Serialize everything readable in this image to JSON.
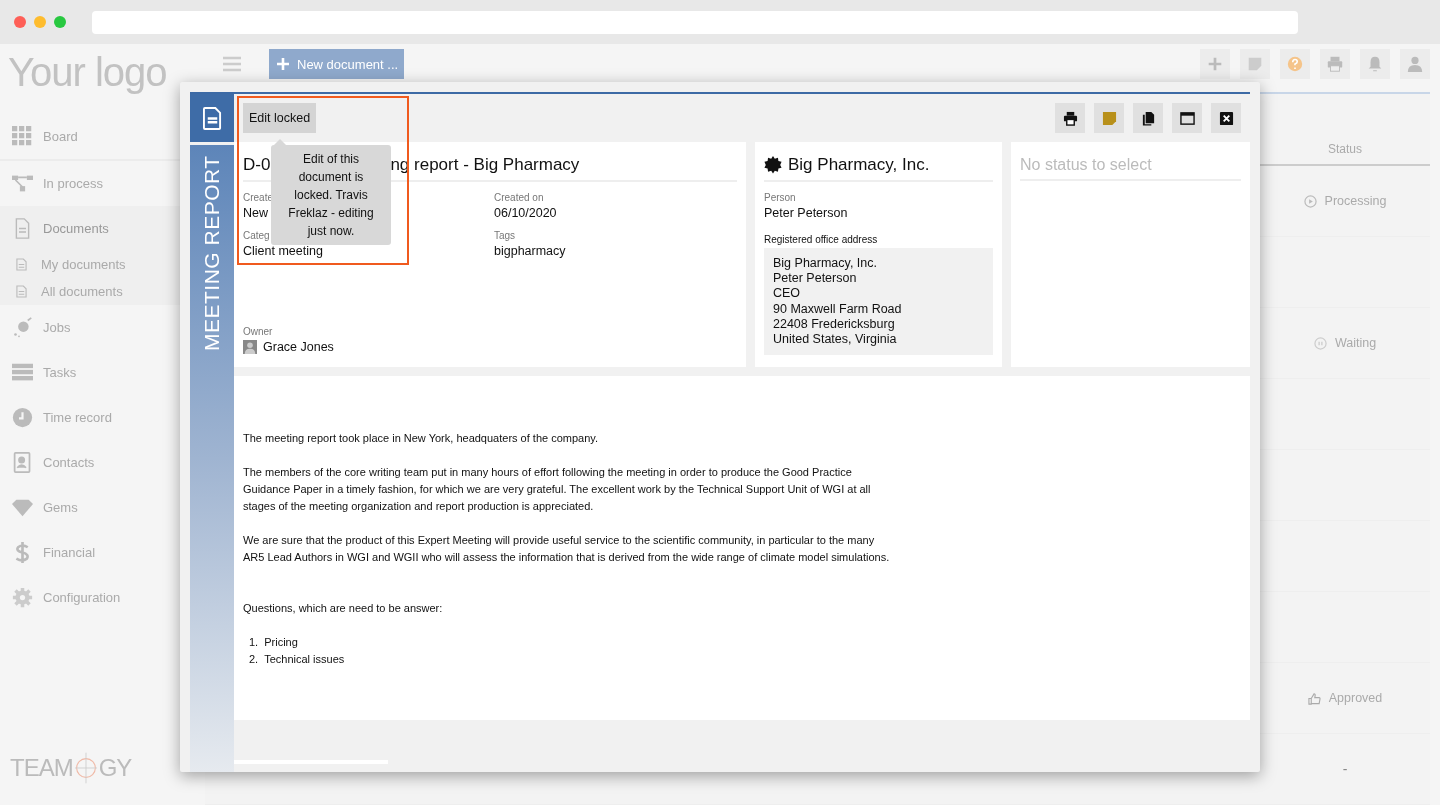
{
  "app": {
    "logo": "Your logo",
    "new_document_button": "New document ...",
    "brand": {
      "left": "TEAM",
      "right": "GY"
    }
  },
  "top_icons": [
    {
      "kind": "plus"
    },
    {
      "kind": "note"
    },
    {
      "kind": "help"
    },
    {
      "kind": "print"
    },
    {
      "kind": "bell"
    },
    {
      "kind": "user"
    }
  ],
  "sidebar": {
    "items": [
      {
        "label": "Board",
        "selected": false
      },
      {
        "label": "In process",
        "selected": false
      },
      {
        "label": "Documents",
        "selected": true,
        "children": [
          {
            "label": "My documents"
          },
          {
            "label": "All documents"
          }
        ]
      },
      {
        "label": "Jobs",
        "selected": false
      },
      {
        "label": "Tasks",
        "selected": false
      },
      {
        "label": "Time record",
        "selected": false
      },
      {
        "label": "Contacts",
        "selected": false
      },
      {
        "label": "Gems",
        "selected": false
      },
      {
        "label": "Financial",
        "selected": false
      },
      {
        "label": "Configuration",
        "selected": false
      }
    ]
  },
  "table": {
    "columns": [
      {
        "label": "Status"
      }
    ],
    "rows": [
      {
        "status": "Processing",
        "kind": "play"
      },
      {
        "kind": "none"
      },
      {
        "status": "Waiting",
        "kind": "pause"
      },
      {
        "kind": "none"
      },
      {
        "kind": "none"
      },
      {
        "kind": "none"
      },
      {
        "kind": "none"
      },
      {
        "status": "Approved",
        "kind": "thumb"
      },
      {
        "status": "-",
        "kind": "dash"
      }
    ]
  },
  "dialog": {
    "side_title": "MEETING REPORT",
    "lock_button": "Edit locked",
    "tooltip": "Edit of this document is locked. Travis Freklaz - editing just now.",
    "toolbar": [
      {
        "kind": "print"
      },
      {
        "kind": "note"
      },
      {
        "kind": "copy"
      },
      {
        "kind": "window"
      },
      {
        "kind": "close"
      }
    ],
    "document": {
      "title_start": "D-0",
      "title_end": "ng report - Big Pharmacy",
      "fields": [
        {
          "label": "Create",
          "value": "New"
        },
        {
          "label": "Created on",
          "value": "06/10/2020"
        },
        {
          "label": "Categ",
          "value": "Client meeting"
        },
        {
          "label": "Tags",
          "value": "bigpharmacy"
        }
      ],
      "owner_label": "Owner",
      "owner": "Grace Jones"
    },
    "company": {
      "name": "Big Pharmacy, Inc.",
      "person_label": "Person",
      "person": "Peter Peterson",
      "address_label": "Registered office address",
      "address": [
        "Big Pharmacy, Inc.",
        "Peter Peterson",
        "CEO",
        "90 Maxwell Farm Road",
        "22408 Fredericksburg",
        "United States, Virginia"
      ]
    },
    "status_placeholder": "No status to select",
    "body": {
      "paragraphs": [
        "The meeting report took place in New York, headquaters of the company.",
        "The members of the core writing team put in many hours of effort following the meeting in order to produce the Good Practice Guidance Paper in a timely fashion, for which we are very grateful. The excellent work by the Technical Support Unit of WGI at all stages of the meeting organization and report production is appreciated.",
        "We are sure that the product of this Expert Meeting will provide useful service to the scientific community, in particular to the many AR5 Lead Authors in WGI and WGII who will assess the information that is derived from the wide range of climate model simulations."
      ],
      "question": "Questions, which are need to be answer:",
      "list": [
        {
          "marker": "1.",
          "text": "Pricing"
        },
        {
          "marker": "2.",
          "text": "Technical issues"
        }
      ]
    }
  }
}
